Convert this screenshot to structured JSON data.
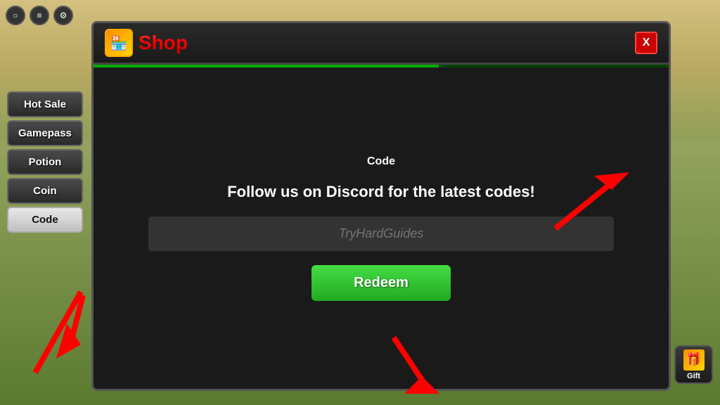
{
  "background": {
    "color": "#5a6e3a"
  },
  "top_icons": [
    {
      "name": "menu-circle",
      "symbol": "○"
    },
    {
      "name": "menu-lines",
      "symbol": "≡"
    },
    {
      "name": "settings",
      "symbol": "⚙"
    }
  ],
  "sidebar": {
    "buttons": [
      {
        "label": "Hot Sale",
        "active": false,
        "id": "hot-sale"
      },
      {
        "label": "Gamepass",
        "active": false,
        "id": "gamepass"
      },
      {
        "label": "Potion",
        "active": false,
        "id": "potion"
      },
      {
        "label": "Coin",
        "active": false,
        "id": "coin"
      },
      {
        "label": "Code",
        "active": true,
        "id": "code"
      }
    ]
  },
  "modal": {
    "title": "Shop",
    "close_label": "X",
    "shop_icon": "🏪",
    "body": {
      "code_label": "Code",
      "discord_text": "Follow us on Discord for the latest codes!",
      "input_placeholder": "TryHardGuides",
      "redeem_label": "Redeem"
    }
  },
  "gift_button": {
    "label": "Gift",
    "icon": "🎁"
  },
  "arrows": {
    "color": "#ff0000",
    "count": 3
  }
}
